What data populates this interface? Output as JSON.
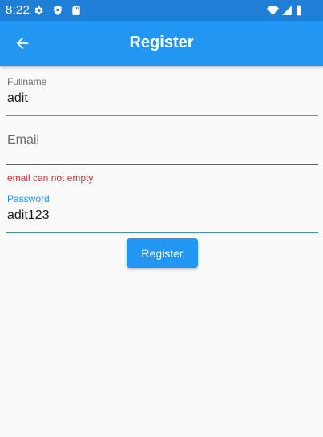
{
  "status_bar": {
    "time": "8:22",
    "icons": [
      "gear-icon",
      "shield-icon",
      "sd-card-icon",
      "wifi-icon",
      "signal-icon",
      "battery-icon"
    ]
  },
  "app_bar": {
    "title": "Register",
    "back_icon": "arrow-back-icon",
    "color": "#2196f3"
  },
  "form": {
    "fullname": {
      "label": "Fullname",
      "value": "adit"
    },
    "email": {
      "label": "Email",
      "value": "",
      "error": "email can not empty",
      "error_color": "#d32f2f"
    },
    "password": {
      "label": "Password",
      "value": "adit123",
      "focus_color": "#2196f3"
    },
    "submit_label": "Register"
  }
}
